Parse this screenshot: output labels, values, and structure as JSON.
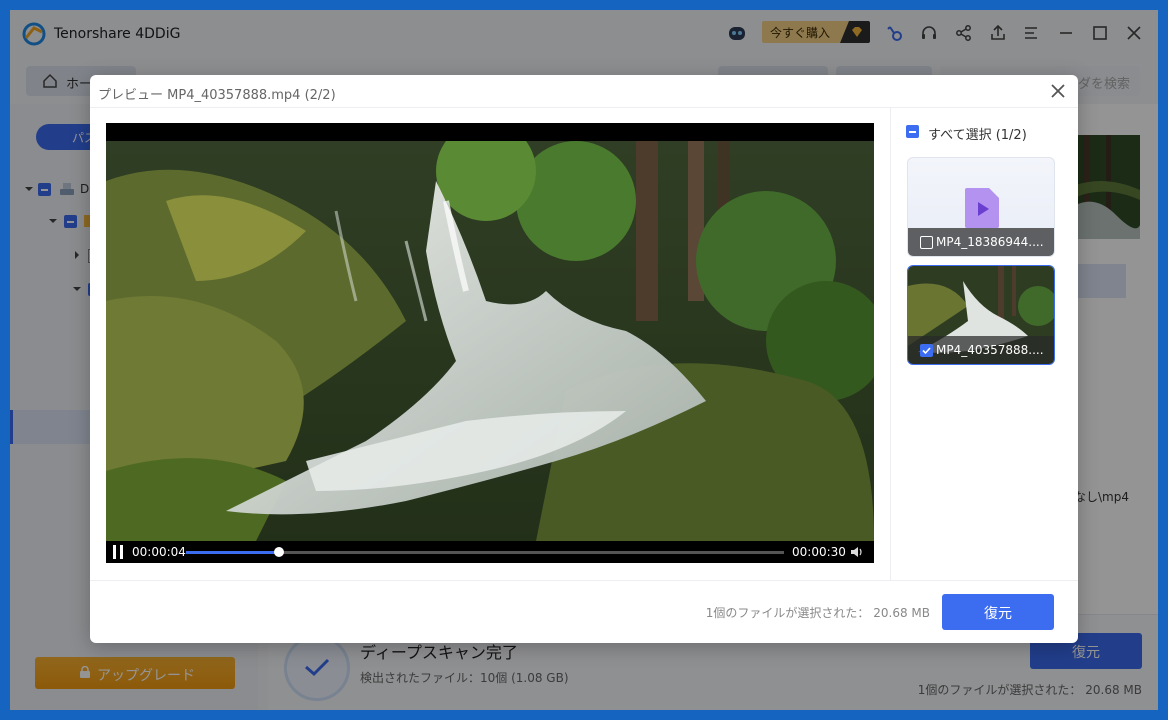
{
  "app": {
    "title": "Tenorshare 4DDiG",
    "buy_label": "今すぐ購入"
  },
  "tabs": {
    "home_label": "ホー",
    "search_placeholder": "ダを検索"
  },
  "sidebar": {
    "pill_label": "パス",
    "drive_label": "D",
    "upgrade_label": "アップグレード"
  },
  "main": {
    "path_text": "なし\\mp4",
    "scan_title": "ディープスキャン完了",
    "scan_sub": "検出されたファイル：10個 (1.08 GB)",
    "recover_label": "復元",
    "selected_info": "1個のファイルが選択された：  20.68 MB"
  },
  "preview": {
    "title": "プレビュー MP4_40357888.mp4 (2/2)",
    "player": {
      "current_time": "00:00:04",
      "duration": "00:00:30",
      "progress": 0.155
    },
    "select_all_label": "すべて選択 (1/2)",
    "files": [
      {
        "name": "MP4_18386944....",
        "checked": false
      },
      {
        "name": "MP4_40357888....",
        "checked": true
      }
    ],
    "selected_info": "1個のファイルが選択された：  20.68 MB",
    "recover_label": "復元"
  },
  "colors": {
    "accent": "#3c6cf0",
    "upgrade": "#f29a10",
    "buy": "#f5d089"
  }
}
